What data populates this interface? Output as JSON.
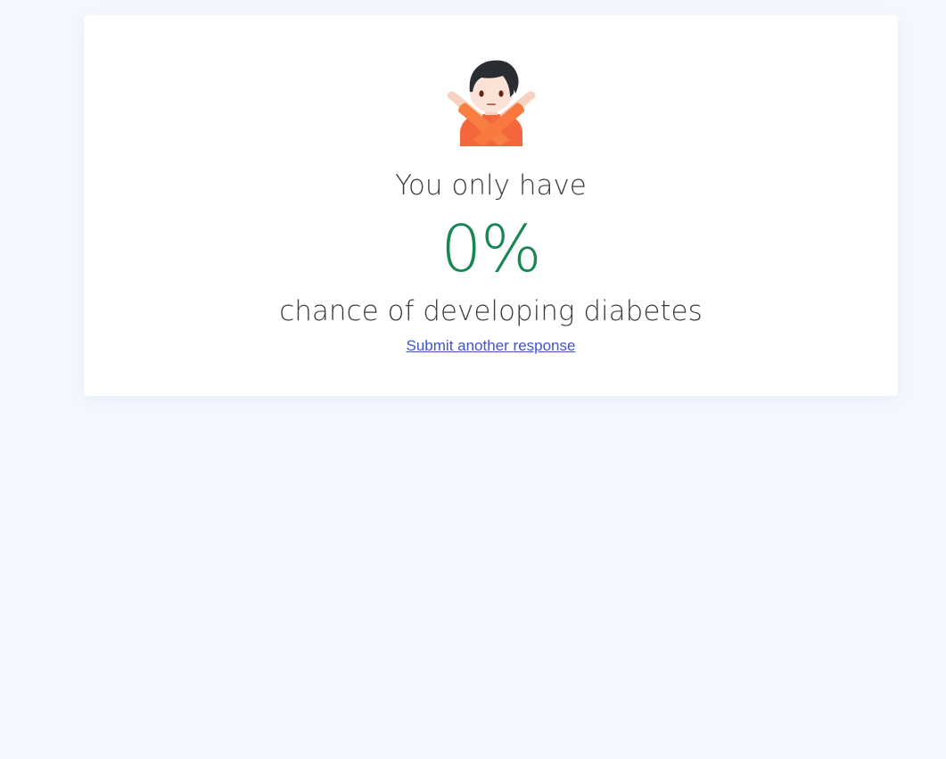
{
  "result": {
    "lead_text": "You only have",
    "percentage": "0%",
    "tail_text": "chance of developing diabetes",
    "submit_again_label": "Submit another response",
    "percentage_color": "#198754",
    "icon": "person-gesturing-no-icon"
  }
}
